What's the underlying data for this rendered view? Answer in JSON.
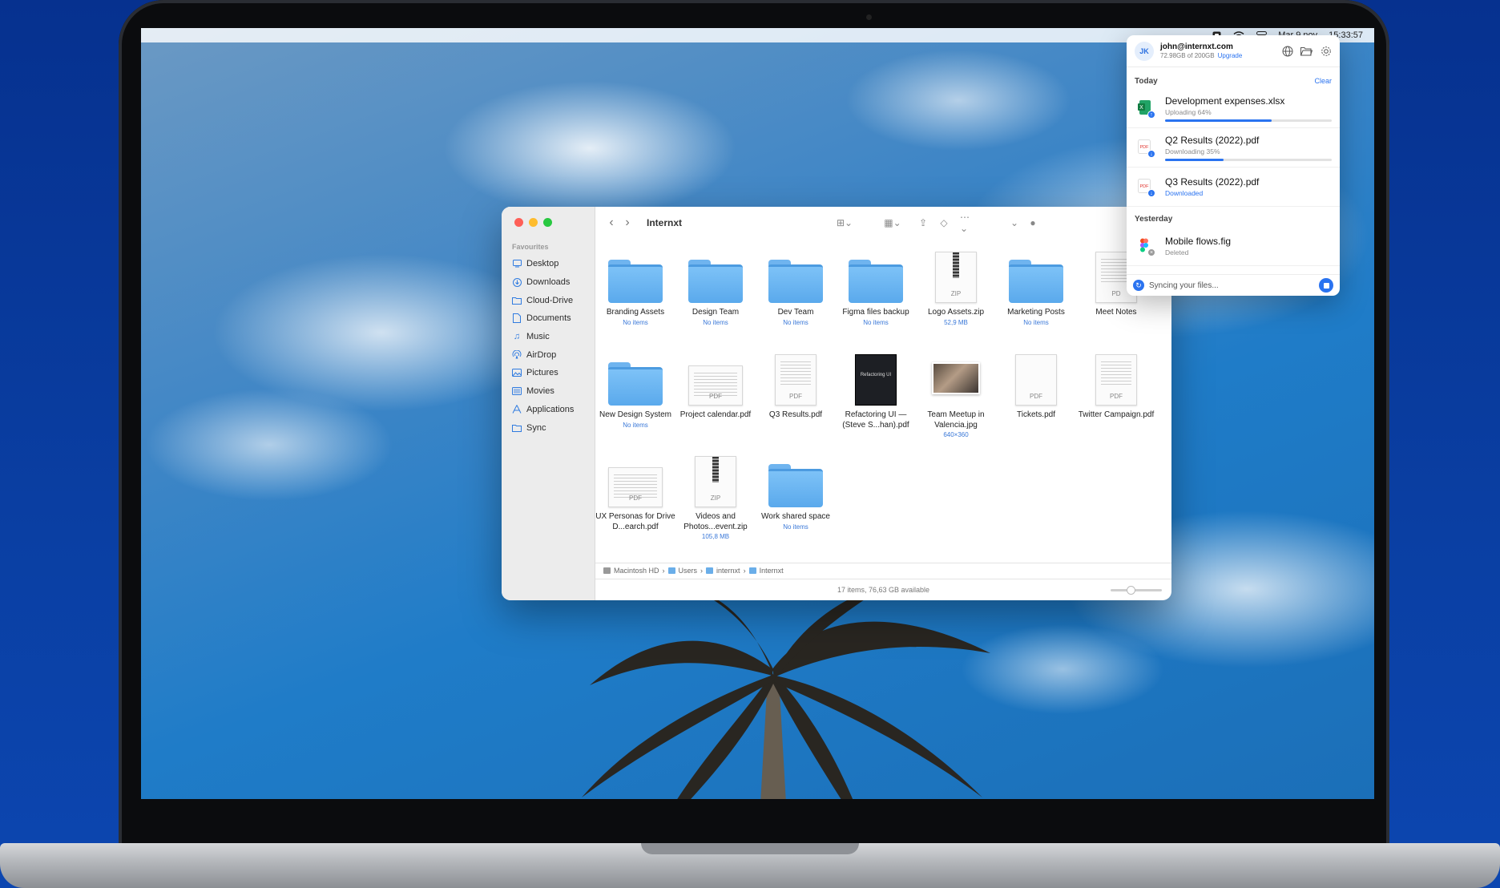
{
  "menubar": {
    "date": "Mar 9 nov",
    "time": "15:33:57"
  },
  "finder": {
    "title": "Internxt",
    "sidebar_heading": "Favourites",
    "sidebar": [
      {
        "label": "Desktop",
        "icon": "desktop-icon"
      },
      {
        "label": "Downloads",
        "icon": "downloads-icon"
      },
      {
        "label": "Cloud-Drive",
        "icon": "folder-icon"
      },
      {
        "label": "Documents",
        "icon": "document-icon"
      },
      {
        "label": "Music",
        "icon": "music-icon"
      },
      {
        "label": "AirDrop",
        "icon": "airdrop-icon"
      },
      {
        "label": "Pictures",
        "icon": "pictures-icon"
      },
      {
        "label": "Movies",
        "icon": "movies-icon"
      },
      {
        "label": "Applications",
        "icon": "applications-icon"
      },
      {
        "label": "Sync",
        "icon": "folder-icon"
      }
    ],
    "files": [
      {
        "name": "Branding Assets",
        "sub": "No items",
        "kind": "folder"
      },
      {
        "name": "Design Team",
        "sub": "No items",
        "kind": "folder"
      },
      {
        "name": "Dev Team",
        "sub": "No items",
        "kind": "folder"
      },
      {
        "name": "Figma files backup",
        "sub": "No items",
        "kind": "folder"
      },
      {
        "name": "Logo Assets.zip",
        "sub": "52,9 MB",
        "kind": "zip",
        "tag": "ZIP"
      },
      {
        "name": "Marketing Posts",
        "sub": "No items",
        "kind": "folder"
      },
      {
        "name": "Meet Notes",
        "sub": "",
        "kind": "pdf",
        "tag": "PD"
      },
      {
        "name": "New Design System",
        "sub": "No items",
        "kind": "folder"
      },
      {
        "name": "Project calendar.pdf",
        "sub": "",
        "kind": "pdf",
        "tag": "PDF"
      },
      {
        "name": "Q3 Results.pdf",
        "sub": "",
        "kind": "pdf",
        "tag": "PDF"
      },
      {
        "name": "Refactoring UI — (Steve S...han).pdf",
        "sub": "",
        "kind": "book",
        "tag": "Refactoring UI"
      },
      {
        "name": "Team Meetup in Valencia.jpg",
        "sub": "640×360",
        "kind": "photo"
      },
      {
        "name": "Tickets.pdf",
        "sub": "",
        "kind": "pdf",
        "tag": "PDF"
      },
      {
        "name": "Twitter Campaign.pdf",
        "sub": "",
        "kind": "pdf",
        "tag": "PDF"
      },
      {
        "name": "UX Personas for Drive D...earch.pdf",
        "sub": "",
        "kind": "pdf",
        "tag": "PDF"
      },
      {
        "name": "Videos and Photos...event.zip",
        "sub": "105,8 MB",
        "kind": "zip",
        "tag": "ZIP"
      },
      {
        "name": "Work shared space",
        "sub": "No items",
        "kind": "folder"
      }
    ],
    "path": [
      "Macintosh HD",
      "Users",
      "internxt",
      "Internxt"
    ],
    "status": "17 items, 76,63 GB available"
  },
  "panel": {
    "avatar": "JK",
    "email": "john@internxt.com",
    "usage": "72.98GB of 200GB",
    "upgrade": "Upgrade",
    "today_label": "Today",
    "clear_label": "Clear",
    "yesterday_label": "Yesterday",
    "items": [
      {
        "name": "Development expenses.xlsx",
        "status": "Uploading 64%",
        "progress": 0.64,
        "type": "xlsx"
      },
      {
        "name": "Q2 Results (2022).pdf",
        "status": "Downloading 35%",
        "progress": 0.35,
        "type": "pdf"
      },
      {
        "name": "Q3 Results (2022).pdf",
        "status": "Downloaded",
        "progress": null,
        "type": "pdf"
      },
      {
        "name": "Mobile flows.fig",
        "status": "Deleted",
        "progress": null,
        "type": "fig"
      }
    ],
    "footer": "Syncing your files...",
    "accent": "#2a73f0"
  }
}
